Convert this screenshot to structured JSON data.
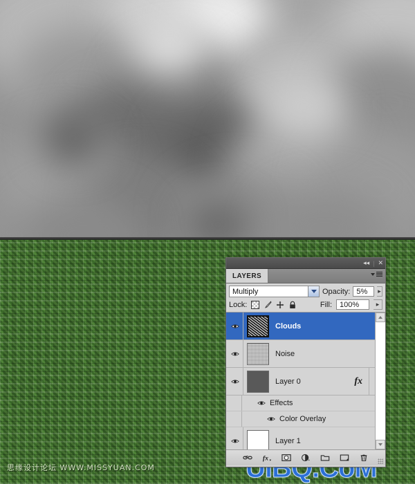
{
  "canvas": {
    "clouds_layer_name": "difference-clouds-render",
    "weave_layer_name": "green-woven-pattern"
  },
  "watermarks": {
    "forum": "思缘设计论坛  WWW.MISSYUAN.COM",
    "site": "UiBQ.CoM"
  },
  "panel": {
    "titlebar": {
      "collapse_label": "◂◂",
      "separator": "|",
      "close_label": "✕"
    },
    "tab_label": "LAYERS",
    "menu_icon": "panel-menu-icon",
    "blend": {
      "mode": "Multiply",
      "opacity_label": "Opacity:",
      "opacity_value": "5%",
      "fill_label": "Fill:",
      "fill_value": "100%",
      "stepper_glyph": "▸"
    },
    "lock": {
      "label": "Lock:",
      "icons": [
        "lock-transparency-icon",
        "lock-image-pixels-icon",
        "lock-position-icon",
        "lock-all-icon"
      ]
    },
    "layers": [
      {
        "name": "Clouds",
        "thumb": "clouds",
        "selected": true,
        "visible": true,
        "has_fx": false
      },
      {
        "name": "Noise",
        "thumb": "noise",
        "selected": false,
        "visible": true,
        "has_fx": false
      },
      {
        "name": "Layer 0",
        "thumb": "gray",
        "selected": false,
        "visible": true,
        "has_fx": true,
        "fx_glyph": "fx"
      }
    ],
    "effects": {
      "group_label": "Effects",
      "items": [
        {
          "label": "Color Overlay",
          "visible": true
        }
      ]
    },
    "bottom_layer": {
      "name": "Layer 1",
      "thumb": "white",
      "selected": false,
      "visible": true
    },
    "footer_icons": [
      "link-layers-icon",
      "add-layer-style-icon",
      "add-layer-mask-icon",
      "new-fill-adjustment-layer-icon",
      "new-group-icon",
      "new-layer-icon",
      "delete-layer-icon"
    ],
    "scrollbar": {
      "up_arrow": "scroll-up-arrow",
      "down_arrow": "scroll-down-arrow"
    }
  },
  "colors": {
    "selection_blue": "#3268bf",
    "panel_gray": "#d6d6d6",
    "weave_green": "#3d6b2c",
    "watermark_blue": "#2b6fd6"
  }
}
